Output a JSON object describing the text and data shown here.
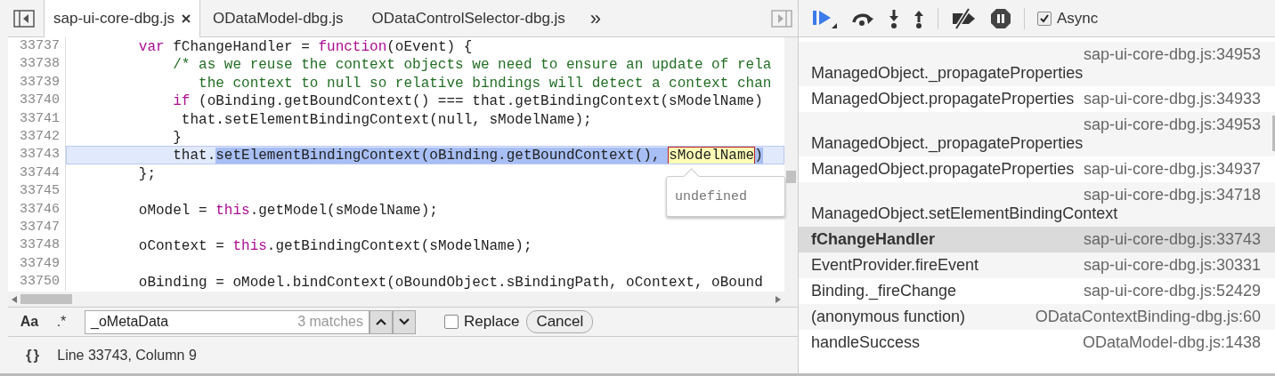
{
  "editor": {
    "tabs": [
      {
        "label": "sap-ui-core-dbg.js",
        "selected": true,
        "closable": true
      },
      {
        "label": "ODataModel-dbg.js",
        "selected": false,
        "closable": false
      },
      {
        "label": "ODataControlSelector-dbg.js",
        "selected": false,
        "closable": false
      }
    ],
    "more_tabs": "»",
    "code_lines": [
      {
        "number": "33737",
        "current": false,
        "segments": [
          {
            "text": "        var",
            "kind": "keyword"
          },
          {
            "text": " fChangeHandler = ",
            "kind": "plain"
          },
          {
            "text": "function",
            "kind": "keyword"
          },
          {
            "text": "(oEvent) {",
            "kind": "plain"
          }
        ]
      },
      {
        "number": "33738",
        "current": false,
        "segments": [
          {
            "text": "            /* as we reuse the context objects we need to ensure an update of rela",
            "kind": "comment"
          }
        ]
      },
      {
        "number": "33739",
        "current": false,
        "segments": [
          {
            "text": "               the context to null so relative bindings will detect a context chan",
            "kind": "comment"
          }
        ]
      },
      {
        "number": "33740",
        "current": false,
        "segments": [
          {
            "text": "            if",
            "kind": "keyword"
          },
          {
            "text": " (oBinding.getBoundContext() === that.getBindingContext(sModelName)",
            "kind": "plain"
          }
        ]
      },
      {
        "number": "33741",
        "current": false,
        "segments": [
          {
            "text": "             that.setElementBindingContext(null, sModelName);",
            "kind": "plain"
          }
        ]
      },
      {
        "number": "33742",
        "current": false,
        "segments": [
          {
            "text": "            }",
            "kind": "plain"
          }
        ]
      },
      {
        "number": "33743",
        "current": true,
        "segments": [
          {
            "text": "            that.",
            "kind": "plain"
          },
          {
            "text": "setElementBindingContext(oBinding.getBoundContext(), ",
            "kind": "selection"
          },
          {
            "text": "sModelName",
            "kind": "hover"
          },
          {
            "text": ")",
            "kind": "selection"
          }
        ]
      },
      {
        "number": "33744",
        "current": false,
        "segments": [
          {
            "text": "        };",
            "kind": "plain"
          }
        ]
      },
      {
        "number": "33745",
        "current": false
      },
      {
        "number": "33746",
        "current": false,
        "segments": [
          {
            "text": "        oModel = ",
            "kind": "plain"
          },
          {
            "text": "this",
            "kind": "keyword"
          },
          {
            "text": ".getModel(sModelName);",
            "kind": "plain"
          }
        ]
      },
      {
        "number": "33747",
        "current": false
      },
      {
        "number": "33748",
        "current": false,
        "segments": [
          {
            "text": "        oContext = ",
            "kind": "plain"
          },
          {
            "text": "this",
            "kind": "keyword"
          },
          {
            "text": ".getBindingContext(sModelName);",
            "kind": "plain"
          }
        ]
      },
      {
        "number": "33749",
        "current": false
      },
      {
        "number": "33750",
        "current": false,
        "segments": [
          {
            "text": "        oBinding = oModel.bindContext(oBoundObject.sBindingPath, oContext, oBound",
            "kind": "plain"
          }
        ]
      }
    ],
    "popover": {
      "value": "undefined"
    },
    "search": {
      "case_toggle": "Aa",
      "regex_toggle": ".*",
      "value": "_oMetaData",
      "match_count": "3 matches",
      "replace": {
        "label": "Replace",
        "checked": false
      },
      "cancel": "Cancel"
    },
    "status_bar": {
      "pretty_print": "{}",
      "position": "Line 33743, Column 9"
    }
  },
  "debugger": {
    "async": {
      "label": "Async",
      "checked": true
    },
    "call_stack": [
      {
        "name": "ManagedObject._propagateProperties",
        "location": "sap-ui-core-dbg.js:34953",
        "selected": false
      },
      {
        "name": "ManagedObject.propagateProperties",
        "location": "sap-ui-core-dbg.js:34933",
        "selected": false
      },
      {
        "name": "ManagedObject._propagateProperties",
        "location": "sap-ui-core-dbg.js:34953",
        "selected": false
      },
      {
        "name": "ManagedObject.propagateProperties",
        "location": "sap-ui-core-dbg.js:34937",
        "selected": false
      },
      {
        "name": "ManagedObject.setElementBindingContext",
        "location": "sap-ui-core-dbg.js:34718",
        "selected": false
      },
      {
        "name": "fChangeHandler",
        "location": "sap-ui-core-dbg.js:33743",
        "selected": true
      },
      {
        "name": "EventProvider.fireEvent",
        "location": "sap-ui-core-dbg.js:30331",
        "selected": false
      },
      {
        "name": "Binding._fireChange",
        "location": "sap-ui-core-dbg.js:52429",
        "selected": false
      },
      {
        "name": "(anonymous function)",
        "location": "ODataContextBinding-dbg.js:60",
        "selected": false
      },
      {
        "name": "handleSuccess",
        "location": "ODataModel-dbg.js:1438",
        "selected": false
      }
    ]
  }
}
